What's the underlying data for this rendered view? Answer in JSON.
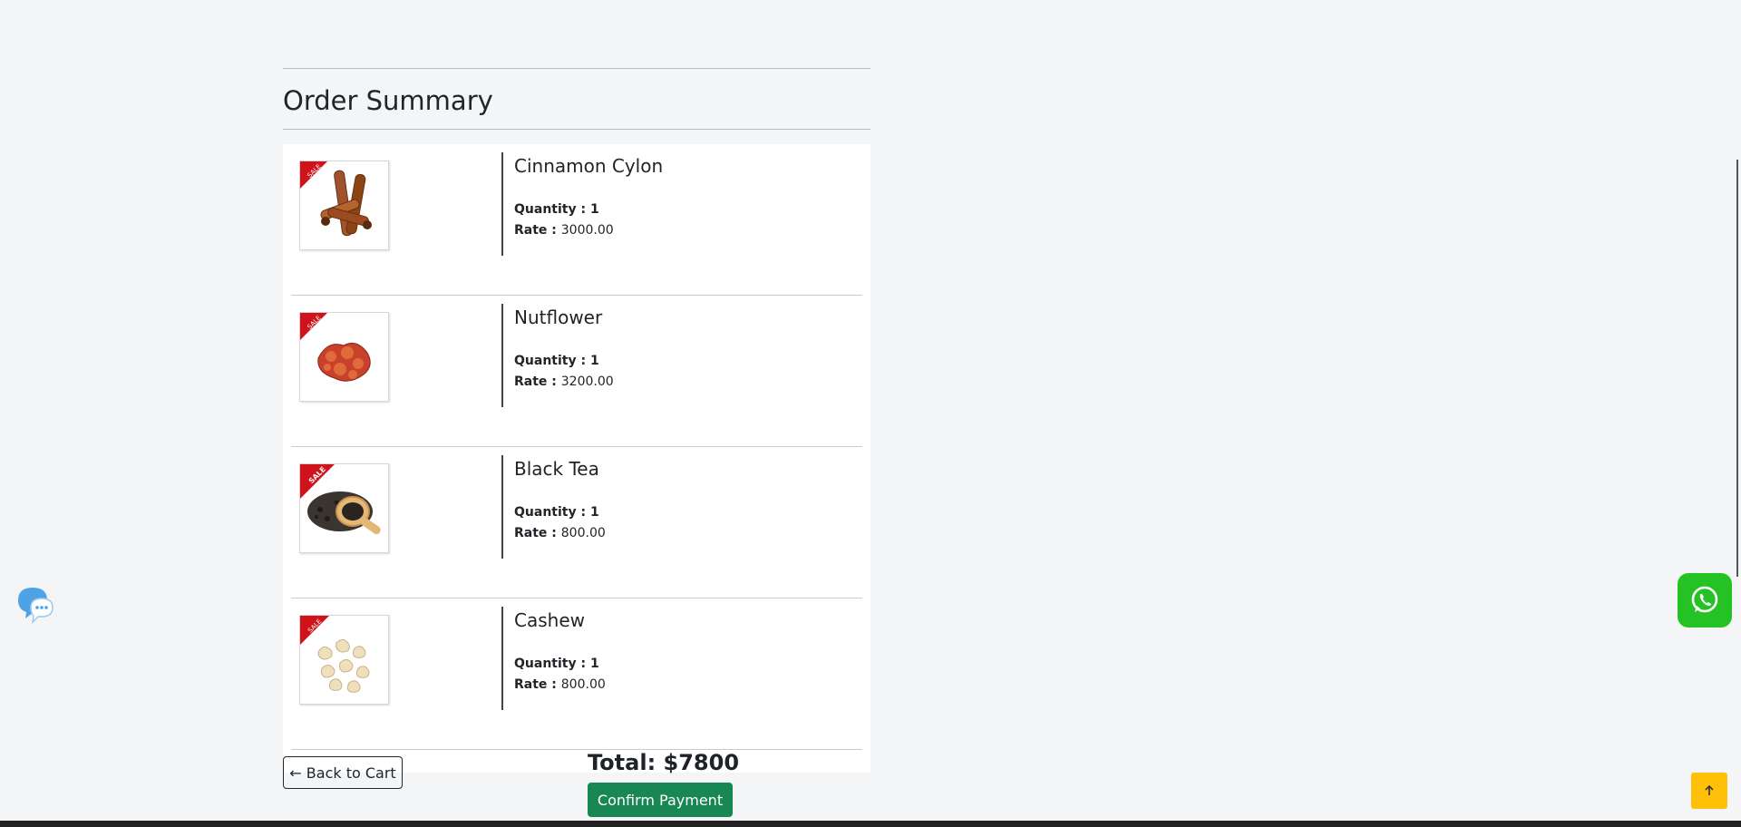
{
  "page": {
    "title": "Order Summary"
  },
  "items": [
    {
      "name": "Cinnamon Cylon",
      "quantity_label": "Quantity : 1",
      "rate_prefix": "Rate :",
      "rate": "3000.00",
      "image": "cinnamon-image",
      "badge": "SALE"
    },
    {
      "name": "Nutflower",
      "quantity_label": "Quantity : 1",
      "rate_prefix": "Rate :",
      "rate": "3200.00",
      "image": "nutflower-image",
      "badge": "SALE"
    },
    {
      "name": "Black Tea",
      "quantity_label": "Quantity : 1",
      "rate_prefix": "Rate :",
      "rate": "800.00",
      "image": "black-tea-image",
      "badge": "SALE"
    },
    {
      "name": "Cashew",
      "quantity_label": "Quantity : 1",
      "rate_prefix": "Rate :",
      "rate": "800.00",
      "image": "cashew-image",
      "badge": "SALE"
    }
  ],
  "footer": {
    "back_label": "← Back to Cart",
    "total_label": "Total: $7800",
    "confirm_label": "Confirm Payment"
  },
  "icons": {
    "chat": "chat-bubble-icon",
    "whatsapp": "whatsapp-icon",
    "scroll_top": "arrow-up-icon"
  },
  "colors": {
    "confirm": "#198754",
    "whatsapp": "#25c225",
    "scroll_top": "#ffc107",
    "sale_badge": "#d0121b"
  }
}
